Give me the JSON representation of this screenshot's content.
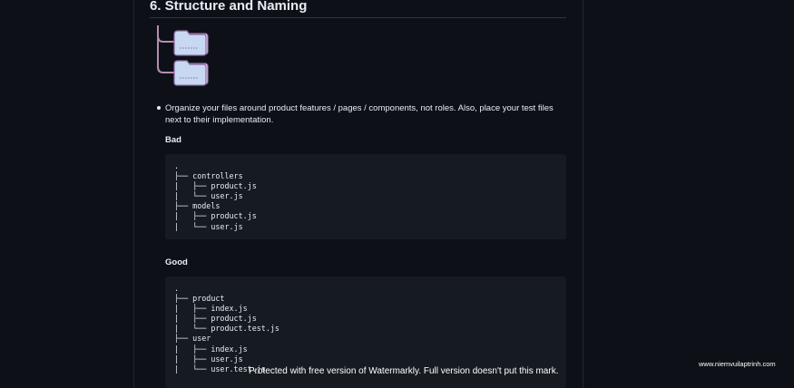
{
  "article": {
    "heading": "6. Structure and Naming",
    "bullet_text": "Organize your files around product features / pages / components, not roles. Also, place your test files next to their implementation.",
    "bad_label": "Bad",
    "good_label": "Good",
    "bad_code": [
      ".",
      "├── controllers",
      "|   ├── product.js",
      "|   └── user.js",
      "├── models",
      "|   ├── product.js",
      "|   └── user.js"
    ],
    "good_code": [
      ".",
      "├── product",
      "|   ├── index.js",
      "|   ├── product.js",
      "|   └── product.test.js",
      "├── user",
      "|   ├── index.js",
      "|   ├── user.js",
      "|   └── user.test.js"
    ]
  },
  "illustration": {
    "icon": "folder-tree-icon",
    "folder_color": "#c8d8f3",
    "line_color": "#b48ead"
  },
  "watermark": "Protected with free version of Watermarkly. Full version doesn't put this mark.",
  "site_mark": "www.niemvuilaptrinh.com",
  "colors": {
    "background": "#0d1117",
    "code_background": "#161b22",
    "text": "#e6edf3"
  }
}
